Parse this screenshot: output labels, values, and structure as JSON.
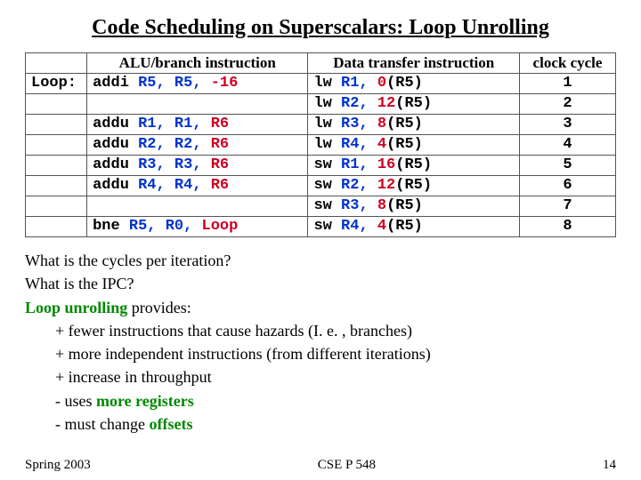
{
  "title": "Code Scheduling on Superscalars: Loop Unrolling",
  "table": {
    "headers": {
      "alu": "ALU/branch instruction",
      "data": "Data transfer instruction",
      "clock": "clock cycle"
    },
    "rows": [
      {
        "label": "Loop:",
        "alu": {
          "op": "addi",
          "r1": "R5,",
          "r2": "R5,",
          "imm": "-16"
        },
        "data": {
          "op": "lw",
          "r": "R1,",
          "off": "0",
          "base": "(R5)"
        },
        "clk": "1"
      },
      {
        "label": "",
        "alu": null,
        "data": {
          "op": "lw",
          "r": "R2,",
          "off": "12",
          "base": "(R5)"
        },
        "clk": "2"
      },
      {
        "label": "",
        "alu": {
          "op": "addu",
          "r1": "R1,",
          "r2": "R1,",
          "imm": "R6"
        },
        "data": {
          "op": "lw",
          "r": "R3,",
          "off": "8",
          "base": "(R5)"
        },
        "clk": "3"
      },
      {
        "label": "",
        "alu": {
          "op": "addu",
          "r1": "R2,",
          "r2": "R2,",
          "imm": "R6"
        },
        "data": {
          "op": "lw",
          "r": "R4,",
          "off": "4",
          "base": "(R5)"
        },
        "clk": "4"
      },
      {
        "label": "",
        "alu": {
          "op": "addu",
          "r1": "R3,",
          "r2": "R3,",
          "imm": "R6"
        },
        "data": {
          "op": "sw",
          "r": "R1,",
          "off": "16",
          "base": "(R5)"
        },
        "clk": "5"
      },
      {
        "label": "",
        "alu": {
          "op": "addu",
          "r1": "R4,",
          "r2": "R4,",
          "imm": "R6"
        },
        "data": {
          "op": "sw",
          "r": "R2,",
          "off": "12",
          "base": "(R5)"
        },
        "clk": "6"
      },
      {
        "label": "",
        "alu": null,
        "data": {
          "op": "sw",
          "r": "R3,",
          "off": "8",
          "base": "(R5)"
        },
        "clk": "7"
      },
      {
        "label": "",
        "alu": {
          "op": "bne",
          "r1": "R5,",
          "r2": "R0,",
          "imm": "Loop"
        },
        "data": {
          "op": "sw",
          "r": "R4,",
          "off": "4",
          "base": "(R5)"
        },
        "clk": "8"
      }
    ]
  },
  "questions": {
    "q1": "What is the cycles per iteration?",
    "q2": "What is the IPC?"
  },
  "unroll": {
    "lead_a": "Loop unrolling",
    "lead_b": " provides:",
    "plus1": "+   fewer instructions that cause hazards (I. e. , branches)",
    "plus2": "+   more independent instructions (from different iterations)",
    "plus3": "+   increase in throughput",
    "minus1_pre": "-   uses ",
    "minus1_em": "more registers",
    "minus2_pre": "-   must change ",
    "minus2_em": "offsets"
  },
  "footer": {
    "left": "Spring 2003",
    "center": "CSE P 548",
    "right": "14"
  }
}
